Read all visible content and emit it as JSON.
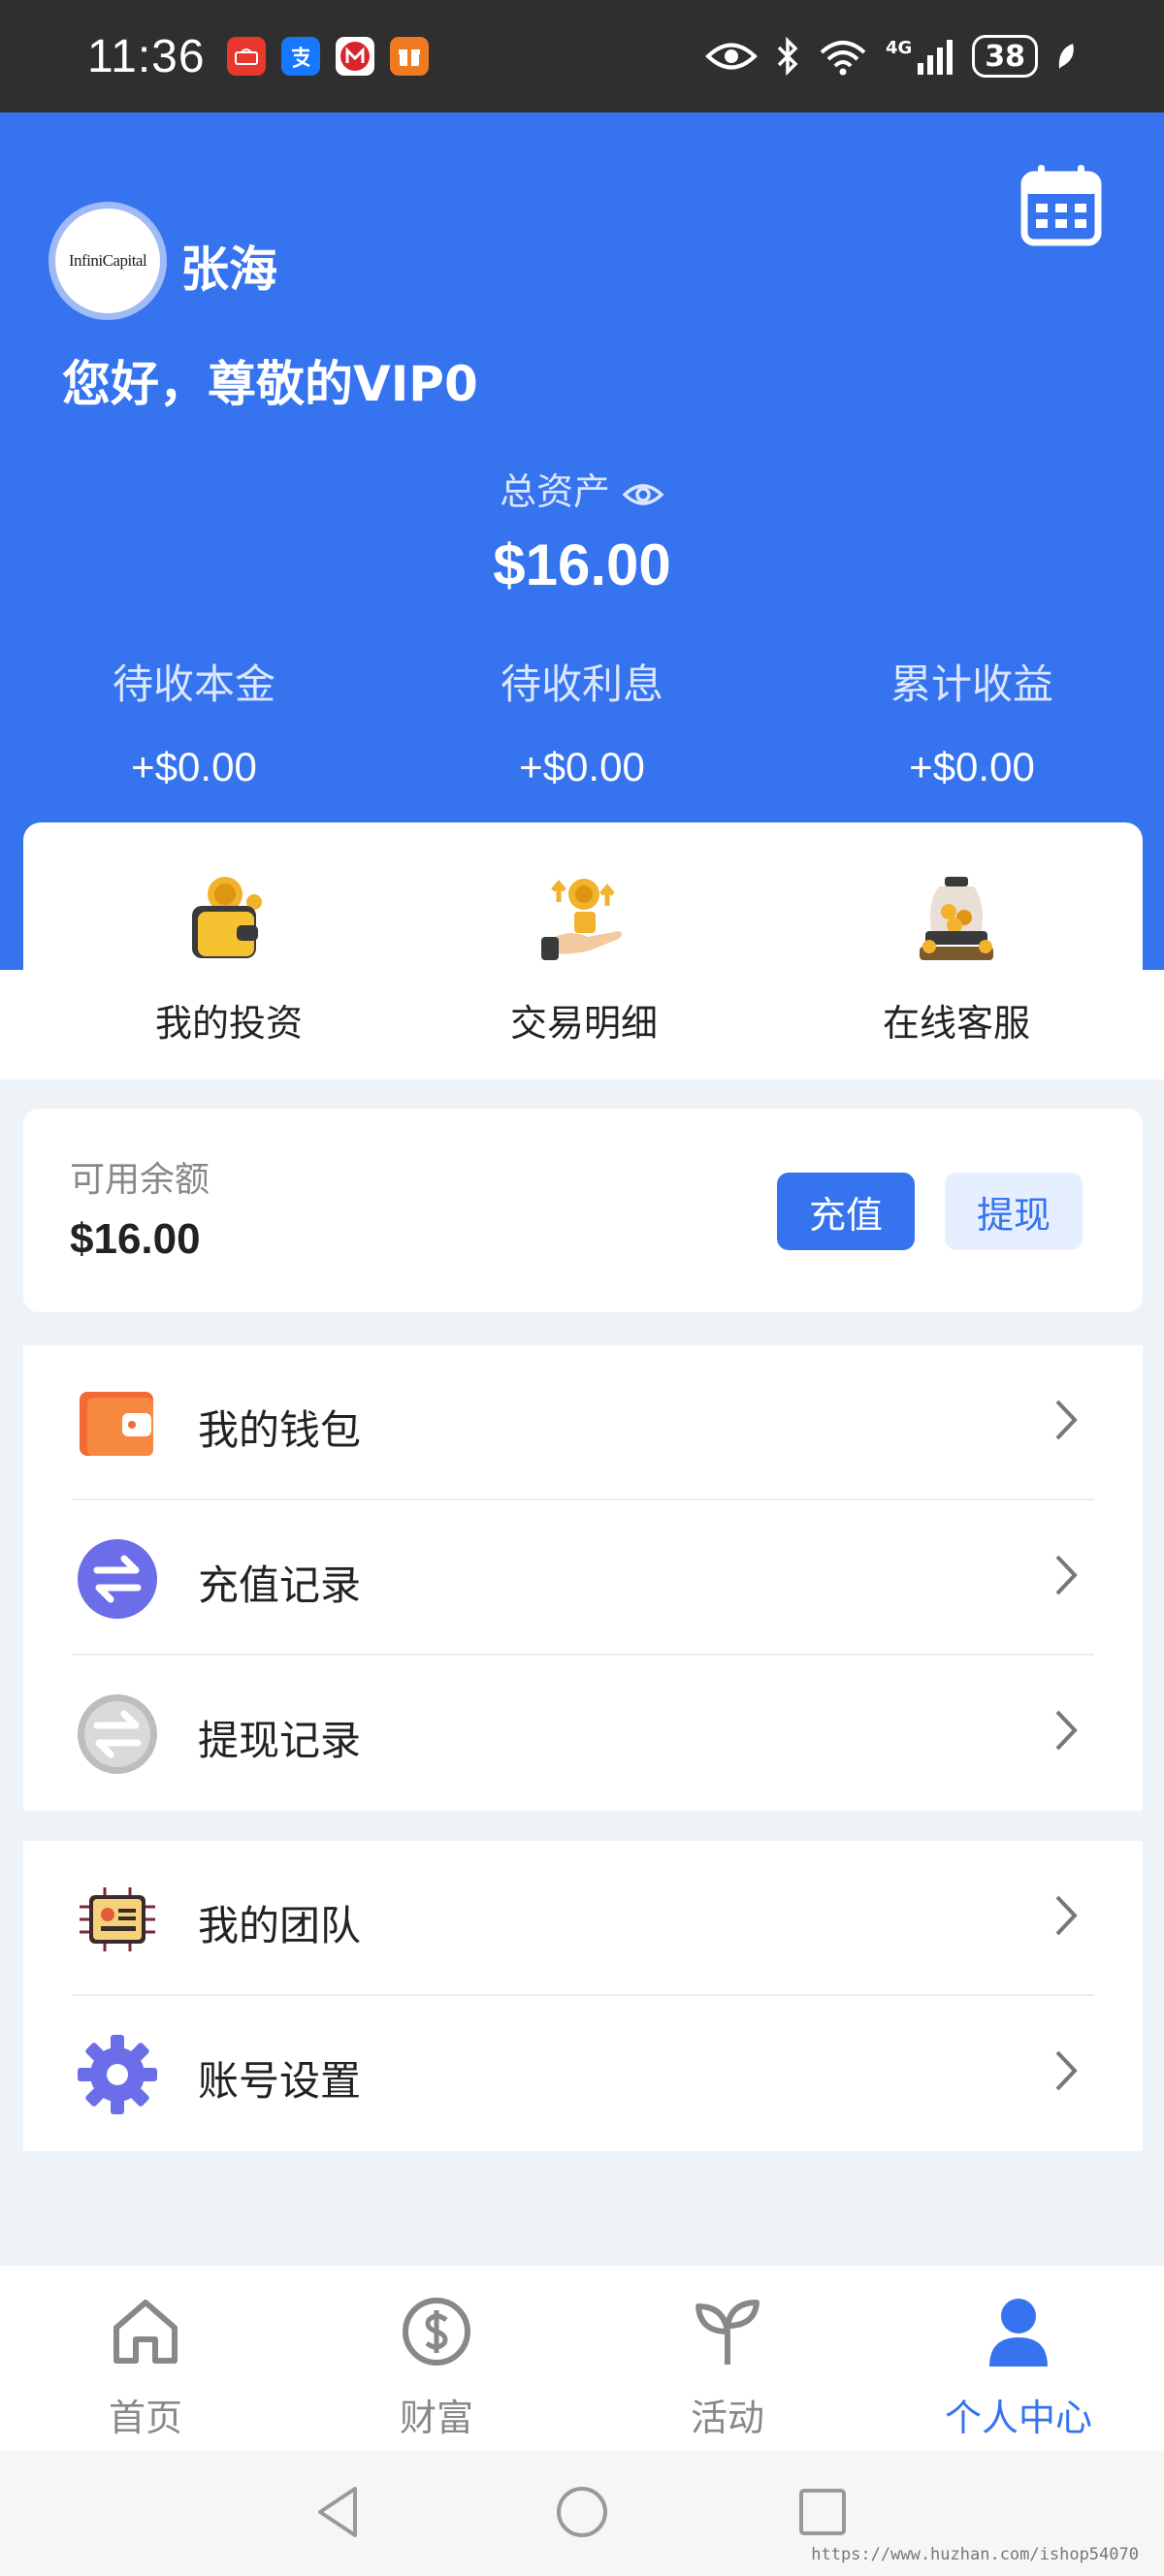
{
  "status_bar": {
    "time": "11:36",
    "network": "4G",
    "battery": "38"
  },
  "header": {
    "avatar_text": "InfiniCapital",
    "username": "张海",
    "greeting": "您好，尊敬的VIP0",
    "total_assets_label": "总资产",
    "total_assets_value": "$16.00",
    "stats": [
      {
        "label": "待收本金",
        "value": "+$0.00"
      },
      {
        "label": "待收利息",
        "value": "+$0.00"
      },
      {
        "label": "累计收益",
        "value": "+$0.00"
      }
    ]
  },
  "quick_actions": [
    {
      "label": "我的投资",
      "icon": "wallet-coins-icon"
    },
    {
      "label": "交易明细",
      "icon": "coin-hand-icon"
    },
    {
      "label": "在线客服",
      "icon": "coin-jar-icon"
    }
  ],
  "balance": {
    "label": "可用余额",
    "value": "$16.00",
    "recharge_label": "充值",
    "withdraw_label": "提现"
  },
  "menu_group_1": [
    {
      "label": "我的钱包",
      "icon": "wallet-icon"
    },
    {
      "label": "充值记录",
      "icon": "exchange-icon"
    },
    {
      "label": "提现记录",
      "icon": "exchange-gray-icon"
    }
  ],
  "menu_group_2": [
    {
      "label": "我的团队",
      "icon": "team-card-icon"
    },
    {
      "label": "账号设置",
      "icon": "gear-icon"
    }
  ],
  "tabs": [
    {
      "label": "首页",
      "icon": "home-icon",
      "active": false
    },
    {
      "label": "财富",
      "icon": "dollar-icon",
      "active": false
    },
    {
      "label": "活动",
      "icon": "sprout-icon",
      "active": false
    },
    {
      "label": "个人中心",
      "icon": "user-icon",
      "active": true
    }
  ],
  "watermark": "https://www.huzhan.com/ishop54070",
  "colors": {
    "primary": "#3673ef",
    "header_bg": "#3673ef",
    "status_bar": "#2f2f2f"
  }
}
